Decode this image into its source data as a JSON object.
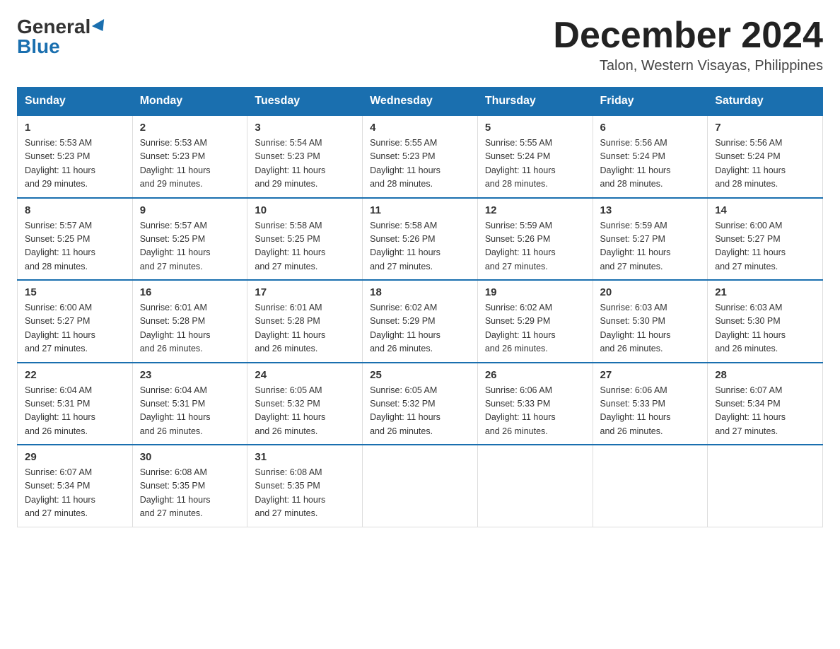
{
  "logo": {
    "general": "General",
    "blue": "Blue"
  },
  "title": {
    "month_year": "December 2024",
    "location": "Talon, Western Visayas, Philippines"
  },
  "days_of_week": [
    "Sunday",
    "Monday",
    "Tuesday",
    "Wednesday",
    "Thursday",
    "Friday",
    "Saturday"
  ],
  "weeks": [
    [
      {
        "day": "1",
        "sunrise": "5:53 AM",
        "sunset": "5:23 PM",
        "daylight": "11 hours and 29 minutes."
      },
      {
        "day": "2",
        "sunrise": "5:53 AM",
        "sunset": "5:23 PM",
        "daylight": "11 hours and 29 minutes."
      },
      {
        "day": "3",
        "sunrise": "5:54 AM",
        "sunset": "5:23 PM",
        "daylight": "11 hours and 29 minutes."
      },
      {
        "day": "4",
        "sunrise": "5:55 AM",
        "sunset": "5:23 PM",
        "daylight": "11 hours and 28 minutes."
      },
      {
        "day": "5",
        "sunrise": "5:55 AM",
        "sunset": "5:24 PM",
        "daylight": "11 hours and 28 minutes."
      },
      {
        "day": "6",
        "sunrise": "5:56 AM",
        "sunset": "5:24 PM",
        "daylight": "11 hours and 28 minutes."
      },
      {
        "day": "7",
        "sunrise": "5:56 AM",
        "sunset": "5:24 PM",
        "daylight": "11 hours and 28 minutes."
      }
    ],
    [
      {
        "day": "8",
        "sunrise": "5:57 AM",
        "sunset": "5:25 PM",
        "daylight": "11 hours and 28 minutes."
      },
      {
        "day": "9",
        "sunrise": "5:57 AM",
        "sunset": "5:25 PM",
        "daylight": "11 hours and 27 minutes."
      },
      {
        "day": "10",
        "sunrise": "5:58 AM",
        "sunset": "5:25 PM",
        "daylight": "11 hours and 27 minutes."
      },
      {
        "day": "11",
        "sunrise": "5:58 AM",
        "sunset": "5:26 PM",
        "daylight": "11 hours and 27 minutes."
      },
      {
        "day": "12",
        "sunrise": "5:59 AM",
        "sunset": "5:26 PM",
        "daylight": "11 hours and 27 minutes."
      },
      {
        "day": "13",
        "sunrise": "5:59 AM",
        "sunset": "5:27 PM",
        "daylight": "11 hours and 27 minutes."
      },
      {
        "day": "14",
        "sunrise": "6:00 AM",
        "sunset": "5:27 PM",
        "daylight": "11 hours and 27 minutes."
      }
    ],
    [
      {
        "day": "15",
        "sunrise": "6:00 AM",
        "sunset": "5:27 PM",
        "daylight": "11 hours and 27 minutes."
      },
      {
        "day": "16",
        "sunrise": "6:01 AM",
        "sunset": "5:28 PM",
        "daylight": "11 hours and 26 minutes."
      },
      {
        "day": "17",
        "sunrise": "6:01 AM",
        "sunset": "5:28 PM",
        "daylight": "11 hours and 26 minutes."
      },
      {
        "day": "18",
        "sunrise": "6:02 AM",
        "sunset": "5:29 PM",
        "daylight": "11 hours and 26 minutes."
      },
      {
        "day": "19",
        "sunrise": "6:02 AM",
        "sunset": "5:29 PM",
        "daylight": "11 hours and 26 minutes."
      },
      {
        "day": "20",
        "sunrise": "6:03 AM",
        "sunset": "5:30 PM",
        "daylight": "11 hours and 26 minutes."
      },
      {
        "day": "21",
        "sunrise": "6:03 AM",
        "sunset": "5:30 PM",
        "daylight": "11 hours and 26 minutes."
      }
    ],
    [
      {
        "day": "22",
        "sunrise": "6:04 AM",
        "sunset": "5:31 PM",
        "daylight": "11 hours and 26 minutes."
      },
      {
        "day": "23",
        "sunrise": "6:04 AM",
        "sunset": "5:31 PM",
        "daylight": "11 hours and 26 minutes."
      },
      {
        "day": "24",
        "sunrise": "6:05 AM",
        "sunset": "5:32 PM",
        "daylight": "11 hours and 26 minutes."
      },
      {
        "day": "25",
        "sunrise": "6:05 AM",
        "sunset": "5:32 PM",
        "daylight": "11 hours and 26 minutes."
      },
      {
        "day": "26",
        "sunrise": "6:06 AM",
        "sunset": "5:33 PM",
        "daylight": "11 hours and 26 minutes."
      },
      {
        "day": "27",
        "sunrise": "6:06 AM",
        "sunset": "5:33 PM",
        "daylight": "11 hours and 26 minutes."
      },
      {
        "day": "28",
        "sunrise": "6:07 AM",
        "sunset": "5:34 PM",
        "daylight": "11 hours and 27 minutes."
      }
    ],
    [
      {
        "day": "29",
        "sunrise": "6:07 AM",
        "sunset": "5:34 PM",
        "daylight": "11 hours and 27 minutes."
      },
      {
        "day": "30",
        "sunrise": "6:08 AM",
        "sunset": "5:35 PM",
        "daylight": "11 hours and 27 minutes."
      },
      {
        "day": "31",
        "sunrise": "6:08 AM",
        "sunset": "5:35 PM",
        "daylight": "11 hours and 27 minutes."
      },
      null,
      null,
      null,
      null
    ]
  ],
  "labels": {
    "sunrise": "Sunrise:",
    "sunset": "Sunset:",
    "daylight": "Daylight:"
  }
}
